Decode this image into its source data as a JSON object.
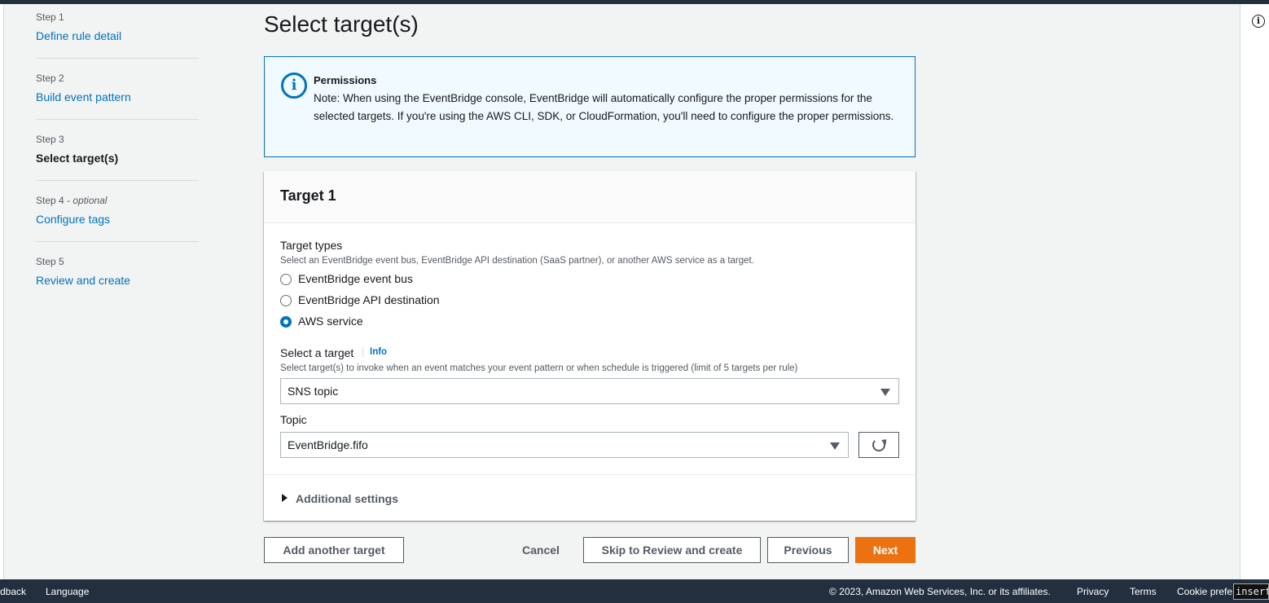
{
  "steps": [
    {
      "label": "Step 1",
      "name": "Define rule detail"
    },
    {
      "label": "Step 2",
      "name": "Build event pattern"
    },
    {
      "label": "Step 3",
      "name": "Select target(s)"
    },
    {
      "label": "Step 4 -",
      "optional": "optional",
      "name": "Configure tags"
    },
    {
      "label": "Step 5",
      "name": "Review and create"
    }
  ],
  "page": {
    "title": "Select target(s)"
  },
  "alert": {
    "title": "Permissions",
    "text": "Note: When using the EventBridge console, EventBridge will automatically configure the proper permissions for the selected targets. If you're using the AWS CLI, SDK, or CloudFormation, you'll need to configure the proper permissions."
  },
  "target": {
    "title": "Target 1",
    "types_label": "Target types",
    "types_desc": "Select an EventBridge event bus, EventBridge API destination (SaaS partner), or another AWS service as a target.",
    "options": [
      "EventBridge event bus",
      "EventBridge API destination",
      "AWS service"
    ],
    "selected_option": "AWS service",
    "select_label": "Select a target",
    "info_link": "Info",
    "select_desc": "Select target(s) to invoke when an event matches your event pattern or when schedule is triggered (limit of 5 targets per rule)",
    "select_value": "SNS topic",
    "topic_label": "Topic",
    "topic_value": "EventBridge.fifo",
    "additional_settings": "Additional settings"
  },
  "actions": {
    "add_target": "Add another target",
    "cancel": "Cancel",
    "skip": "Skip to Review and create",
    "previous": "Previous",
    "next": "Next"
  },
  "footer": {
    "feedback": "dback",
    "language": "Language",
    "copyright": "© 2023, Amazon Web Services, Inc. or its affiliates.",
    "privacy": "Privacy",
    "terms": "Terms",
    "cookie": "Cookie prefe",
    "insert": "insert"
  },
  "colors": {
    "accent": "#0073bb",
    "primary_button": "#ec7211",
    "header": "#232f3e"
  },
  "icons": {
    "alert": "info-circle-icon",
    "refresh": "refresh-icon",
    "rail": "info-icon"
  }
}
